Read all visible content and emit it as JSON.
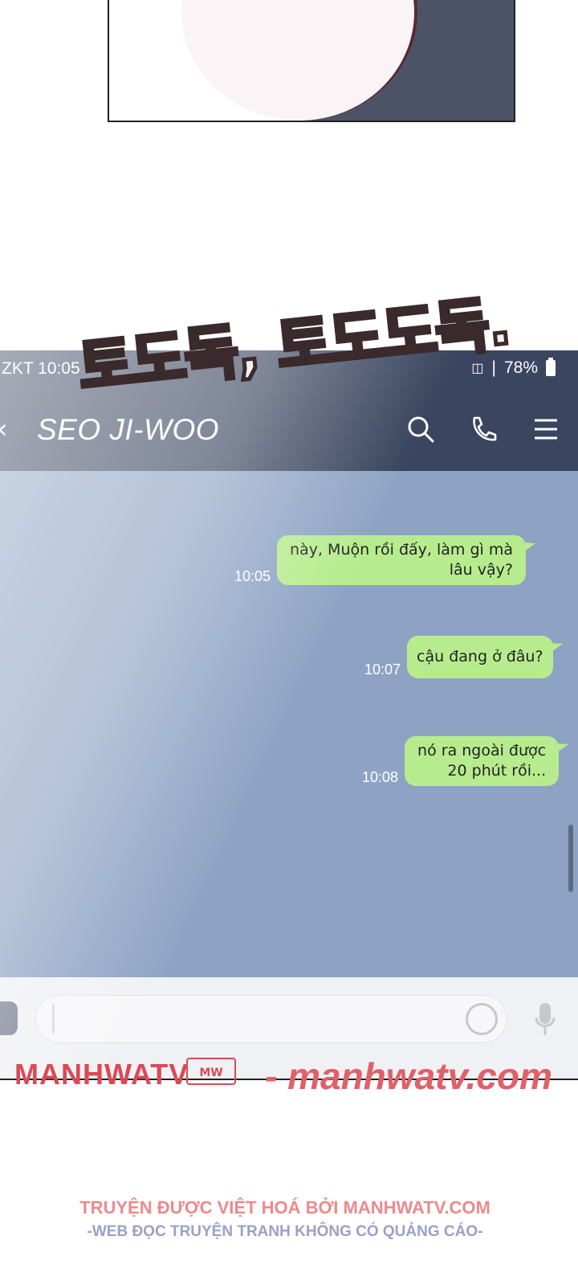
{
  "status_bar": {
    "time": "ZKT 10:05",
    "battery": "78%"
  },
  "header": {
    "contact_name": "SEO JI-WOO",
    "back_icon": "chevron-left-icon",
    "search_icon": "search-icon",
    "call_icon": "phone-icon",
    "menu_icon": "menu-icon"
  },
  "sound_effect": "토도독, 토도도독.",
  "messages": [
    {
      "time": "10:05",
      "text": "này, Muộn rồi đấy, làm gì mà\nlâu vậy?"
    },
    {
      "time": "10:07",
      "text": "cậu đang ở đâu?"
    },
    {
      "time": "10:08",
      "text": "nó ra ngoài được\n20 phút rồi..."
    }
  ],
  "input_bar": {
    "attach_icon": "attach-icon",
    "emoji_icon": "emoji-icon",
    "mic_icon": "mic-icon"
  },
  "watermark": {
    "brand": "MANHWATV",
    "logo_text": "MW",
    "url": "- manhwatv.com"
  },
  "credits": {
    "line1": "TRUYỆN ĐƯỢC VIỆT HOÁ BỞI MANHWATV.COM",
    "line2": "-WEB ĐỌC TRUYỆN TRANH KHÔNG CÓ QUẢNG CÁO-"
  },
  "colors": {
    "chat_bg": "#8ea3c4",
    "bubble": "#b7ec8e",
    "header": "#3a455f",
    "watermark": "#d94a56"
  }
}
